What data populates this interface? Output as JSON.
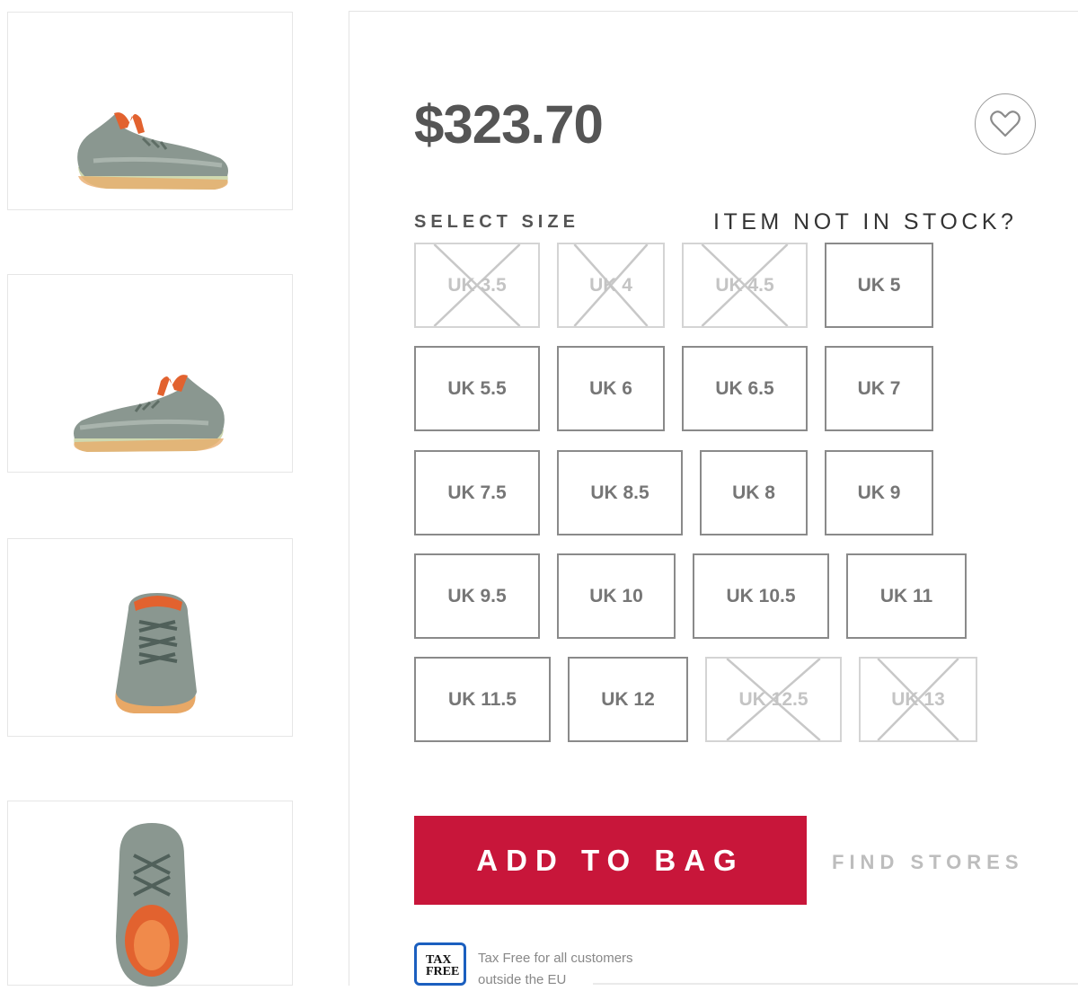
{
  "product": {
    "price": "$323.70",
    "wishlist_icon": "heart-outline-icon",
    "select_size_label": "SELECT SIZE",
    "not_in_stock_label": "ITEM NOT IN STOCK?",
    "thumbnails": [
      {
        "view": "side-left"
      },
      {
        "view": "side-right"
      },
      {
        "view": "front"
      },
      {
        "view": "top"
      }
    ],
    "colors": {
      "upper": "#8a9790",
      "accent": "#e2622f",
      "sole": "#cfd9b0",
      "sole_edge": "#e8a866"
    }
  },
  "sizes": [
    {
      "label": "UK 3.5",
      "available": false
    },
    {
      "label": "UK 4",
      "available": false
    },
    {
      "label": "UK 4.5",
      "available": false
    },
    {
      "label": "UK 5",
      "available": true
    },
    {
      "label": "UK 5.5",
      "available": true
    },
    {
      "label": "UK 6",
      "available": true
    },
    {
      "label": "UK 6.5",
      "available": true
    },
    {
      "label": "UK 7",
      "available": true
    },
    {
      "label": "UK 7.5",
      "available": true
    },
    {
      "label": "UK 8.5",
      "available": true
    },
    {
      "label": "UK 8",
      "available": true
    },
    {
      "label": "UK 9",
      "available": true
    },
    {
      "label": "UK 9.5",
      "available": true
    },
    {
      "label": "UK 10",
      "available": true
    },
    {
      "label": "UK 10.5",
      "available": true
    },
    {
      "label": "UK 11",
      "available": true
    },
    {
      "label": "UK 11.5",
      "available": true
    },
    {
      "label": "UK 12",
      "available": true
    },
    {
      "label": "UK 12.5",
      "available": false
    },
    {
      "label": "UK 13",
      "available": false
    }
  ],
  "actions": {
    "add_to_bag": "ADD TO BAG",
    "find_stores": "FIND STORES",
    "accent_color": "#c8163a"
  },
  "tax_free": {
    "logo_line1": "TAX",
    "logo_line2": "FREE",
    "text_line1": "Tax Free for all customers",
    "text_line2": "outside the EU"
  }
}
